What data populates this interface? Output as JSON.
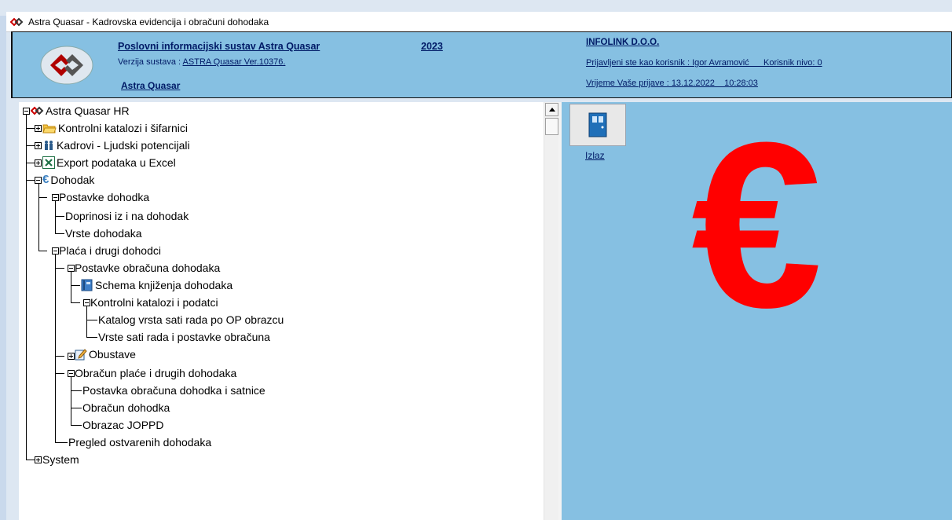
{
  "window": {
    "title": "Astra Quasar - Kadrovska evidencija i obračuni dohodaka"
  },
  "header": {
    "system_title": "Poslovni informacijski sustav Astra Quasar",
    "year": "2023",
    "version_label": "Verzija sustava : ",
    "version_value": "ASTRA Quasar Ver.10376.",
    "short_name": "Astra Quasar",
    "company": "INFOLINK D.O.O.",
    "user_line": "Prijavljeni ste kao korisnik : Igor Avramović      Korisnik nivo: 0",
    "login_line": "Vrijeme Vaše prijave : 13.12.2022    10:28:03"
  },
  "tree": {
    "root": "Astra Quasar HR",
    "items": [
      {
        "label": "Kontrolni katalozi i šifarnici"
      },
      {
        "label": "Kadrovi - Ljudski potencijali"
      },
      {
        "label": "Export podataka u Excel"
      },
      {
        "label": "Dohodak"
      },
      {
        "label": "Postavke dohodka"
      },
      {
        "label": "Doprinosi iz i na dohodak"
      },
      {
        "label": "Vrste dohodaka"
      },
      {
        "label": "Plaća i drugi dohodci"
      },
      {
        "label": "Postavke obračuna dohodaka"
      },
      {
        "label": "Schema knjiženja dohodaka"
      },
      {
        "label": "Kontrolni katalozi i podatci"
      },
      {
        "label": "Katalog vrsta sati rada po OP obrazcu"
      },
      {
        "label": "Vrste sati rada i postavke obračuna"
      },
      {
        "label": "Obustave"
      },
      {
        "label": "Obračun plaće i drugih dohodaka"
      },
      {
        "label": "Postavka obračuna dohodka i satnice"
      },
      {
        "label": "Obračun dohodka"
      },
      {
        "label": "Obrazac JOPPD"
      },
      {
        "label": "Pregled ostvarenih dohodaka"
      },
      {
        "label": "System"
      }
    ]
  },
  "right_panel": {
    "exit_label": "Izlaz",
    "currency_symbol": "€"
  },
  "colors": {
    "header_bg": "#86c0e2",
    "accent_red": "#ff0000",
    "link_blue": "#001a66"
  },
  "icons": [
    "astra-logo-icon",
    "folder-icon",
    "people-icon",
    "excel-icon",
    "euro-icon",
    "book-icon",
    "edit-icon",
    "door-icon"
  ]
}
